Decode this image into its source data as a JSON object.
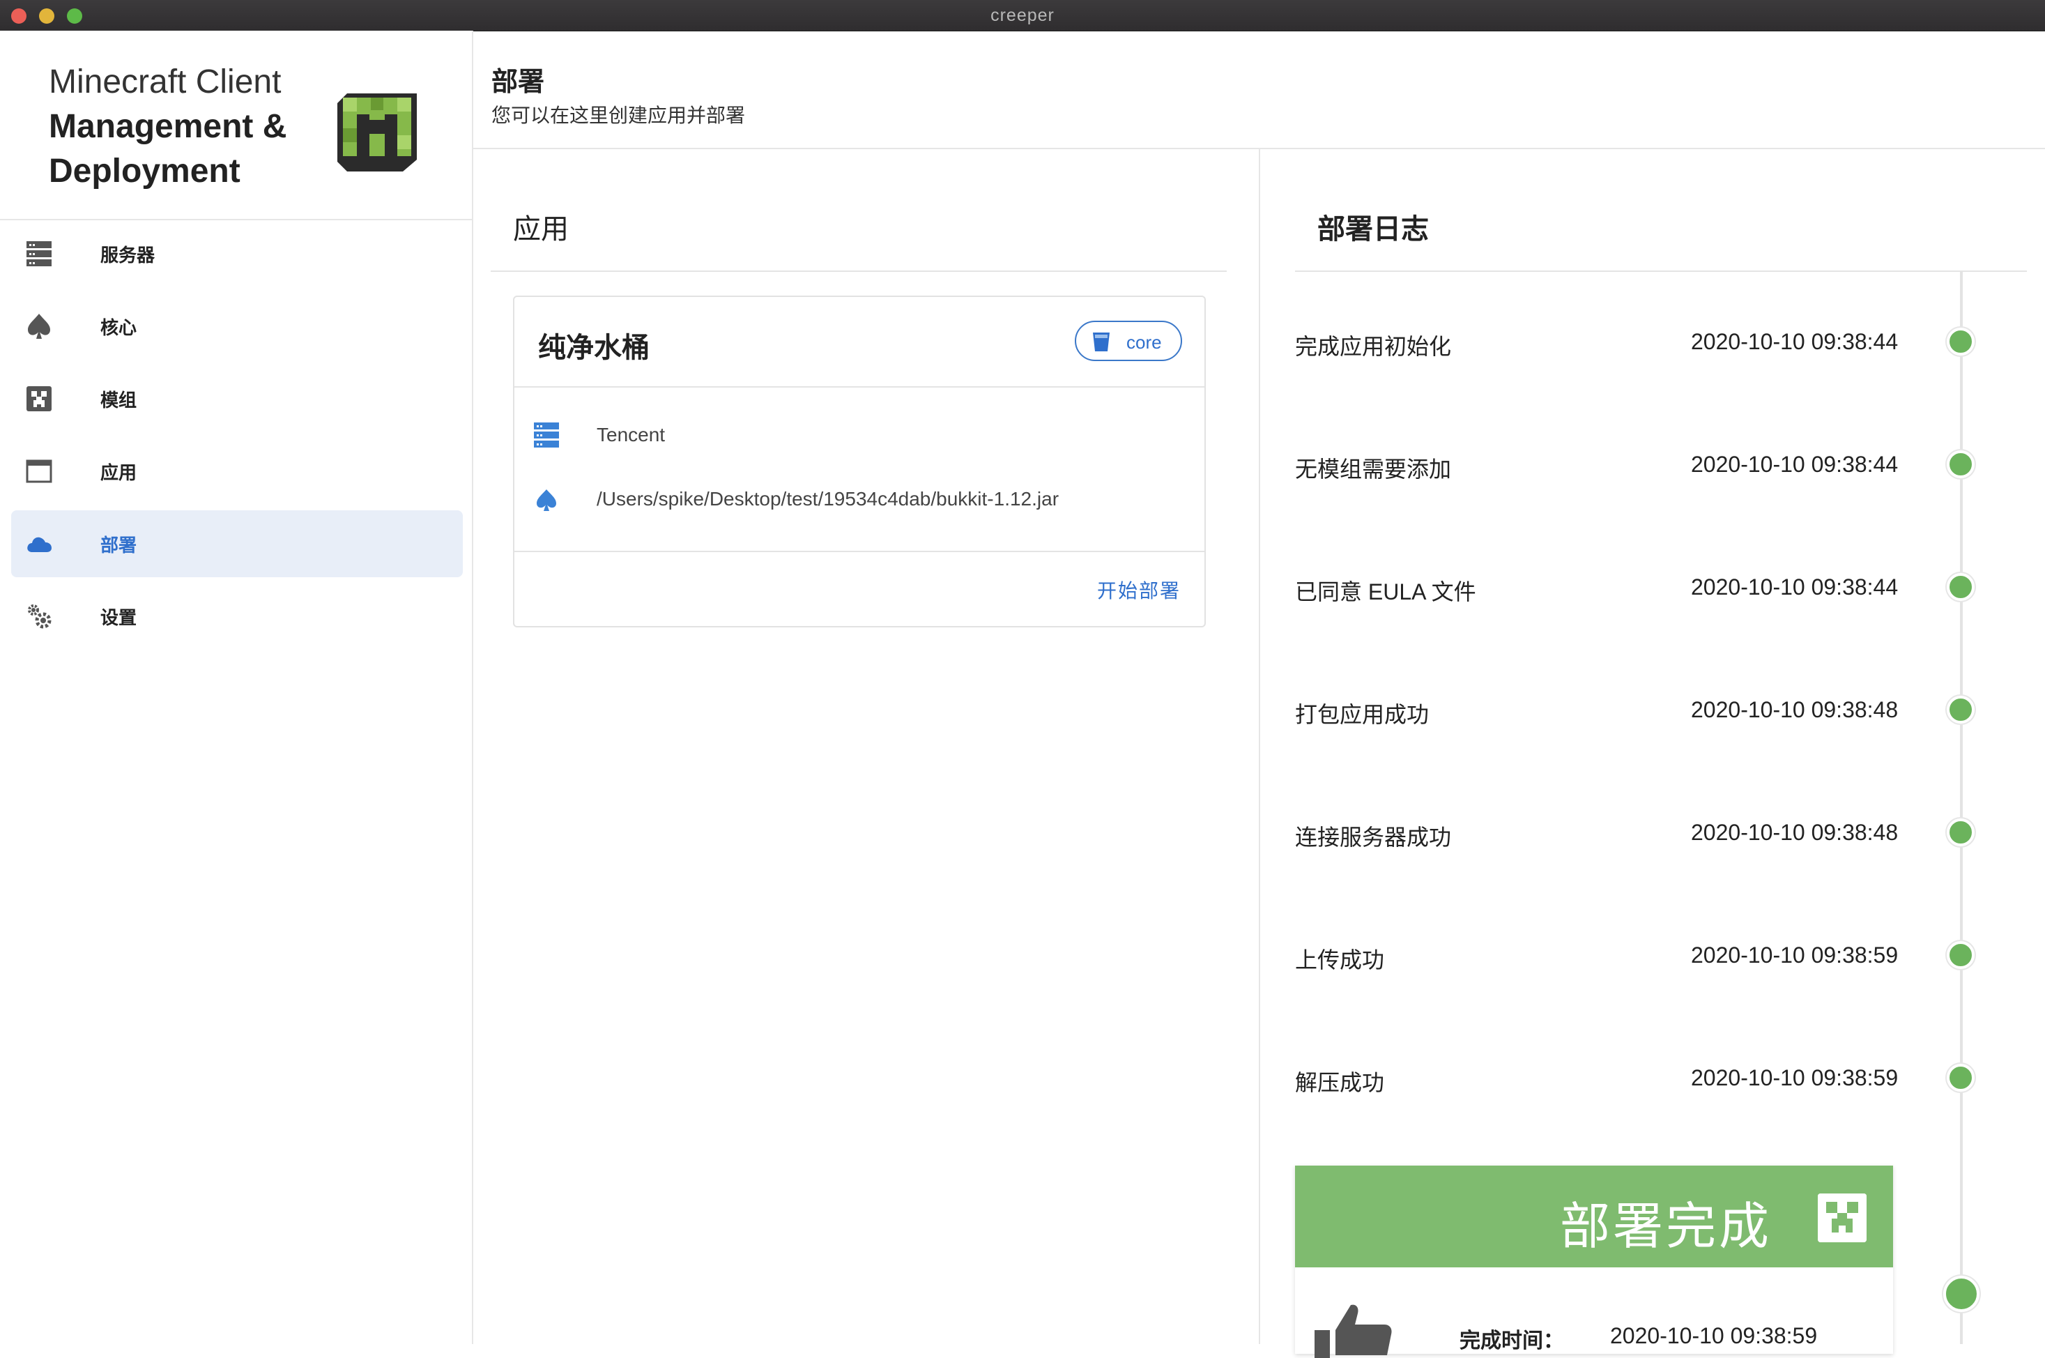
{
  "window": {
    "title": "creeper"
  },
  "brand": {
    "line1": "Minecraft Client",
    "line2": "Management &",
    "line3": "Deployment"
  },
  "sidebar": {
    "items": [
      {
        "label": "服务器",
        "icon": "server-icon"
      },
      {
        "label": "核心",
        "icon": "spade-icon"
      },
      {
        "label": "模组",
        "icon": "creeper-icon"
      },
      {
        "label": "应用",
        "icon": "window-icon"
      },
      {
        "label": "部署",
        "icon": "cloud-icon",
        "active": true
      },
      {
        "label": "设置",
        "icon": "gears-icon"
      }
    ]
  },
  "header": {
    "title": "部署",
    "subtitle": "您可以在这里创建应用并部署"
  },
  "apps": {
    "title": "应用",
    "card": {
      "name": "纯净水桶",
      "chip": "core",
      "server": "Tencent",
      "core_path": "/Users/spike/Desktop/test/19534c4dab/bukkit-1.12.jar",
      "action": "开始部署"
    }
  },
  "log": {
    "title": "部署日志",
    "entries": [
      {
        "text": "完成应用初始化",
        "time": "2020-10-10 09:38:44"
      },
      {
        "text": "无模组需要添加",
        "time": "2020-10-10 09:38:44"
      },
      {
        "text": "已同意 EULA 文件",
        "time": "2020-10-10 09:38:44"
      },
      {
        "text": "打包应用成功",
        "time": "2020-10-10 09:38:48"
      },
      {
        "text": "连接服务器成功",
        "time": "2020-10-10 09:38:48"
      },
      {
        "text": "上传成功",
        "time": "2020-10-10 09:38:59"
      },
      {
        "text": "解压成功",
        "time": "2020-10-10 09:38:59"
      }
    ],
    "done": {
      "title": "部署完成",
      "label": "完成时间：",
      "time": "2020-10-10 09:38:59"
    }
  },
  "colors": {
    "accent": "#2f6fcc",
    "success": "#6bb35c",
    "banner": "#7fbb6f",
    "active_bg": "#e8eef8"
  }
}
